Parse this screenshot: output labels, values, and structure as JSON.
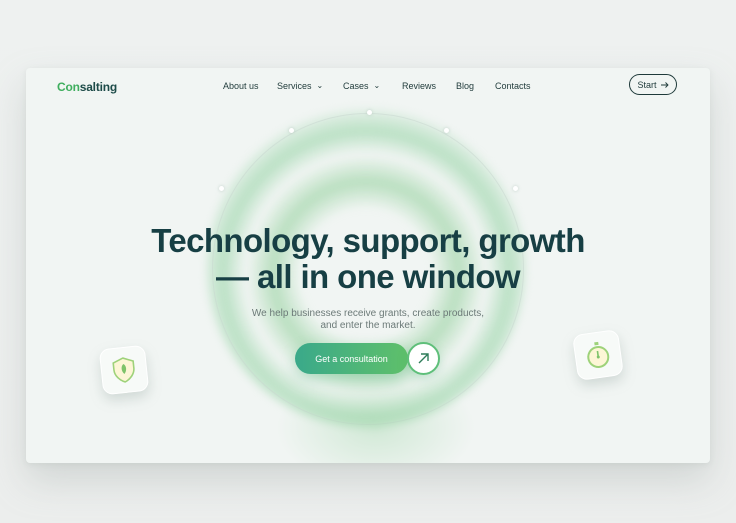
{
  "logo": {
    "prefix": "Con",
    "rest": "salting"
  },
  "nav": {
    "about": "About us",
    "services": "Services",
    "cases": "Cases",
    "reviews": "Reviews",
    "blog": "Blog",
    "contacts": "Contacts",
    "start": "Start"
  },
  "hero": {
    "title_line1": "Technology, support, growth",
    "title_line2": "— all in one window",
    "sub_line1": "We help businesses receive grants, create products,",
    "sub_line2": "and enter the market.",
    "cta": "Get a consultation"
  },
  "colors": {
    "accent": "#3fae5e",
    "dark": "#173f44",
    "cta_start": "#3aa98a",
    "cta_end": "#5fc06a"
  },
  "icons": {
    "left_tile": "shield-icon",
    "right_tile": "stopwatch-icon",
    "cta_arrow": "arrow-up-right-icon",
    "start_arrow": "arrow-right-icon"
  }
}
